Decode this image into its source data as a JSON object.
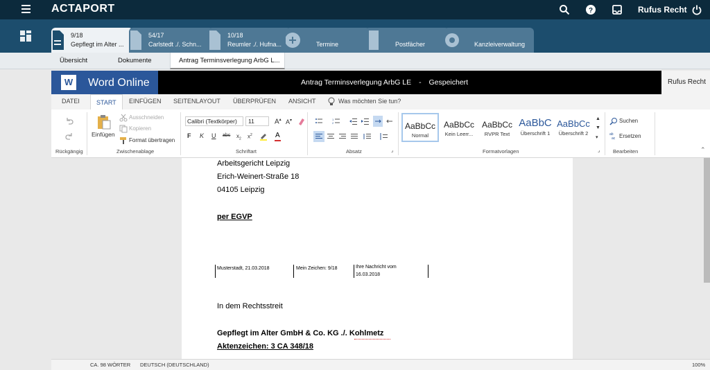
{
  "topbar": {
    "logo": "ACTAPORT",
    "user": "Rufus Recht"
  },
  "tabs": [
    {
      "count": "9/18",
      "title": "Gepflegt im Alter ..."
    },
    {
      "count": "54/17",
      "title": "Carlstedt ./. Schn..."
    },
    {
      "count": "10/18",
      "title": "Reumler ./. Hufna..."
    }
  ],
  "modules": [
    "Termine",
    "Postfächer",
    "Kanzleiverwaltung"
  ],
  "subtabs": [
    "Übersicht",
    "Dokumente",
    "Antrag Terminsverlegung ArbG L..."
  ],
  "word": {
    "app": "Word Online",
    "doc_title": "Antrag Terminsverlegung ArbG LE",
    "separator": "-",
    "status": "Gespeichert",
    "user": "Rufus Recht"
  },
  "ribbon_tabs": [
    "DATEI",
    "START",
    "EINFÜGEN",
    "SEITENLAYOUT",
    "ÜBERPRÜFEN",
    "ANSICHT"
  ],
  "tell_me": "Was möchten Sie tun?",
  "ribbon": {
    "undo_group": "Rückgängig",
    "clipboard_group": "Zwischenablage",
    "paste": "Einfügen",
    "cut": "Ausschneiden",
    "copy": "Kopieren",
    "format_painter": "Format übertragen",
    "font_group": "Schriftart",
    "font_name": "Calibri (Textkörper)",
    "font_size": "11",
    "para_group": "Absatz",
    "styles_group": "Formatvorlagen",
    "edit_group": "Bearbeiten",
    "find": "Suchen",
    "replace": "Ersetzen",
    "styles": [
      {
        "sample": "AaBbCc",
        "name": "Normal"
      },
      {
        "sample": "AaBbCc",
        "name": "Kein Leerr..."
      },
      {
        "sample": "AaBbCc",
        "name": "RVPR Text"
      },
      {
        "sample": "AaBbC",
        "name": "Überschrift 1"
      },
      {
        "sample": "AaBbCc",
        "name": "Überschrift 2"
      }
    ]
  },
  "document": {
    "addr1": "Arbeitsgericht Leipzig",
    "addr2": "Erich-Weinert-Straße 18",
    "addr3": "04105 Leipzig",
    "via": "per EGVP",
    "date": "Musterstadt, 21.03.2018",
    "ref": "Mein Zeichen: 9/18",
    "your_msg1": "Ihre Nachricht vom",
    "your_msg2": "16.03.2018",
    "case_intro": "In dem Rechtsstreit",
    "case_title": "Gepflegt im Alter GmbH & Co. KG ./. Kohlmetz",
    "case_no": "Aktenzeichen: 3 CA 348/18"
  },
  "status": {
    "words": "CA. 98 WÖRTER",
    "lang": "DEUTSCH (DEUTSCHLAND)",
    "zoom": "100%"
  }
}
